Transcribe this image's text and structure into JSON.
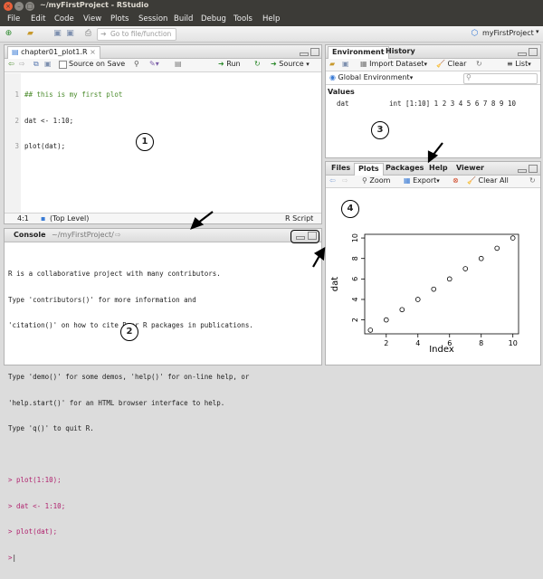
{
  "window": {
    "title": "~/myFirstProject - RStudio"
  },
  "menu": [
    "File",
    "Edit",
    "Code",
    "View",
    "Plots",
    "Session",
    "Build",
    "Debug",
    "Tools",
    "Help"
  ],
  "toolbar": {
    "goto_placeholder": "Go to file/function",
    "project": "myFirstProject"
  },
  "source": {
    "tab": "chapter01_plot1.R",
    "source_on_save": "Source on Save",
    "run": "Run",
    "source_btn": "Source",
    "line_numbers": [
      "1",
      "2",
      "3"
    ],
    "lines": [
      "## this is my first plot",
      "dat <- 1:10;",
      "plot(dat);"
    ],
    "status_pos": "4:1",
    "status_scope": "(Top Level)",
    "status_type": "R Script",
    "marker": "1"
  },
  "console": {
    "title": "Console",
    "path": "~/myFirstProject/",
    "lines": [
      "R is a collaborative project with many contributors.",
      "Type 'contributors()' for more information and",
      "'citation()' on how to cite R or R packages in publications.",
      "",
      "Type 'demo()' for some demos, 'help()' for on-line help, or",
      "'help.start()' for an HTML browser interface to help.",
      "Type 'q()' to quit R.",
      ""
    ],
    "commands": [
      "> plot(1:10);",
      "> dat <- 1:10;",
      "> plot(dat);",
      ">"
    ],
    "marker": "2"
  },
  "environment": {
    "tabs": [
      "Environment",
      "History"
    ],
    "import_dataset": "Import Dataset",
    "clear": "Clear",
    "list": "List",
    "global_env": "Global Environment",
    "section": "Values",
    "var_name": "dat",
    "var_value": "int [1:10] 1 2 3 4 5 6 7 8 9 10",
    "marker": "3"
  },
  "files": {
    "tabs": [
      "Files",
      "Plots",
      "Packages",
      "Help",
      "Viewer"
    ],
    "zoom": "Zoom",
    "export": "Export",
    "clear_all": "Clear All",
    "marker": "4"
  },
  "chart_data": {
    "type": "scatter",
    "x": [
      1,
      2,
      3,
      4,
      5,
      6,
      7,
      8,
      9,
      10
    ],
    "y": [
      1,
      2,
      3,
      4,
      5,
      6,
      7,
      8,
      9,
      10
    ],
    "xlabel": "Index",
    "ylabel": "dat",
    "xticks": [
      "2",
      "4",
      "6",
      "8",
      "10"
    ],
    "yticks": [
      "2",
      "4",
      "6",
      "8",
      "10"
    ],
    "xlim": [
      0.64,
      10.36
    ],
    "ylim": [
      0.64,
      10.36
    ]
  },
  "colors": {
    "titlebar": "#3c3b37",
    "accent": "#f07746",
    "prompt": "#b0226e",
    "comment": "#4a8b2b"
  }
}
